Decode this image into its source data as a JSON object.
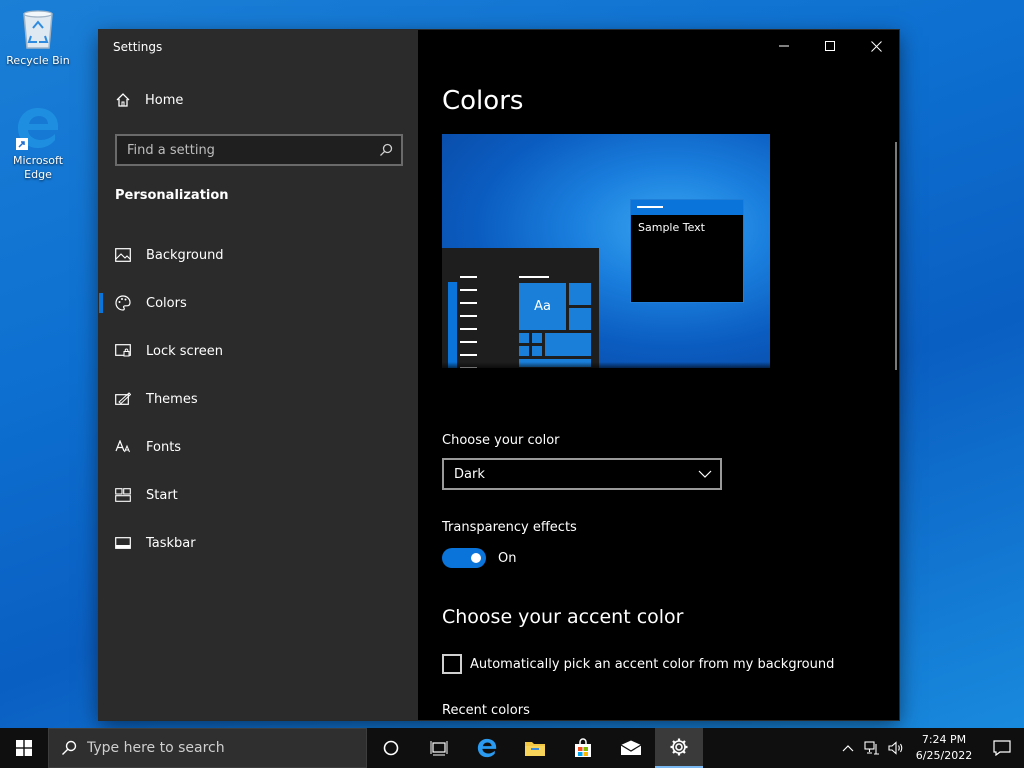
{
  "desktop": {
    "icons": [
      {
        "label": "Recycle Bin",
        "icon": "recycle-bin-icon"
      },
      {
        "label": "Microsoft Edge",
        "icon": "edge-icon"
      }
    ]
  },
  "window": {
    "title": "Settings",
    "controls": [
      "minimize-icon",
      "maximize-icon",
      "close-icon"
    ]
  },
  "sidebar": {
    "home_label": "Home",
    "search_placeholder": "Find a setting",
    "section": "Personalization",
    "items": [
      {
        "label": "Background",
        "icon": "picture-icon",
        "active": false
      },
      {
        "label": "Colors",
        "icon": "palette-icon",
        "active": true
      },
      {
        "label": "Lock screen",
        "icon": "lock-screen-icon",
        "active": false
      },
      {
        "label": "Themes",
        "icon": "themes-icon",
        "active": false
      },
      {
        "label": "Fonts",
        "icon": "fonts-icon",
        "active": false
      },
      {
        "label": "Start",
        "icon": "start-icon",
        "active": false
      },
      {
        "label": "Taskbar",
        "icon": "taskbar-icon",
        "active": false
      }
    ]
  },
  "main": {
    "title": "Colors",
    "preview": {
      "sample_text": "Sample Text",
      "tile_text": "Aa"
    },
    "choose_color_label": "Choose your color",
    "choose_color_value": "Dark",
    "transparency_label": "Transparency effects",
    "transparency_state": "On",
    "accent_title": "Choose your accent color",
    "auto_accent_label": "Automatically pick an accent color from my background",
    "recent_colors_label": "Recent colors"
  },
  "taskbar": {
    "search_placeholder": "Type here to search",
    "clock_time": "7:24 PM",
    "clock_date": "6/25/2022"
  },
  "colors": {
    "accent": "#0a74da",
    "sidebar_bg": "#2b2b2b",
    "content_bg": "#000000"
  }
}
